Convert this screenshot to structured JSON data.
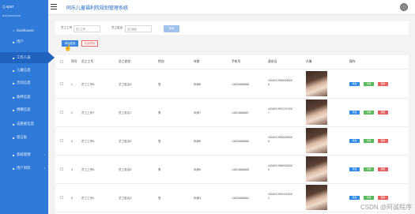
{
  "app": {
    "logo_text": "aper",
    "title": "同乐儿童福利院规划管理系统",
    "nav_caption": "MAIN NAVIGATION"
  },
  "sidebar": {
    "items": [
      {
        "icon": "⌂",
        "label": "Dashboard",
        "active": false,
        "chevron": false
      },
      {
        "icon": "■",
        "label": "用户",
        "active": false,
        "chevron": false
      },
      {
        "icon": "■",
        "label": "工作人员",
        "active": true,
        "chevron": false
      },
      {
        "icon": "■",
        "label": "儿童信息",
        "active": false,
        "chevron": false
      },
      {
        "icon": "■",
        "label": "活动信息",
        "active": false,
        "chevron": false
      },
      {
        "icon": "■",
        "label": "收养信息",
        "active": false,
        "chevron": false
      },
      {
        "icon": "■",
        "label": "捐赠信息",
        "active": false,
        "chevron": false
      },
      {
        "icon": "■",
        "label": "志愿者信息",
        "active": false,
        "chevron": false
      },
      {
        "icon": "■",
        "label": "留言板",
        "active": false,
        "chevron": false
      },
      {
        "icon": "■",
        "label": "系统管理",
        "active": false,
        "chevron": true
      },
      {
        "icon": "■",
        "label": "用户资料",
        "active": false,
        "chevron": true
      }
    ]
  },
  "search": {
    "label1": "员工工号",
    "placeholder1": "员工工号",
    "label2": "员工姓名",
    "placeholder2": "员工姓名",
    "button": "查询"
  },
  "toolbar": {
    "add": "添加信息",
    "delete": "批量删除"
  },
  "table": {
    "headers": [
      "序号",
      "员工工号",
      "员工姓名",
      "性别",
      "年龄",
      "手机号",
      "身份证",
      "头像",
      "操作"
    ],
    "rows": [
      {
        "index": "1",
        "emp_no": "员工工号8",
        "name": "员工姓名8",
        "gender": "男",
        "age": "年龄8",
        "phone": "13823888888",
        "id_card": "440300199808080008"
      },
      {
        "index": "2",
        "emp_no": "员工工号7",
        "name": "员工姓名7",
        "gender": "男",
        "age": "年龄7",
        "phone": "13823888887",
        "id_card": "440300199707070007"
      },
      {
        "index": "3",
        "emp_no": "员工工号6",
        "name": "员工姓名6",
        "gender": "男",
        "age": "年龄6",
        "phone": "13823888886",
        "id_card": "440300199606060006"
      },
      {
        "index": "4",
        "emp_no": "员工工号5",
        "name": "员工姓名5",
        "gender": "男",
        "age": "年龄5",
        "phone": "13823888885",
        "id_card": "440300199505050005"
      },
      {
        "index": "5",
        "emp_no": "员工工号4",
        "name": "员工姓名4",
        "gender": "男",
        "age": "年龄4",
        "phone": "13823888884",
        "id_card": "440300199404040004"
      }
    ],
    "actions": {
      "edit": "修改",
      "view": "详情",
      "delete": "删除"
    }
  },
  "watermark": "CSDN @阿诚程序"
}
